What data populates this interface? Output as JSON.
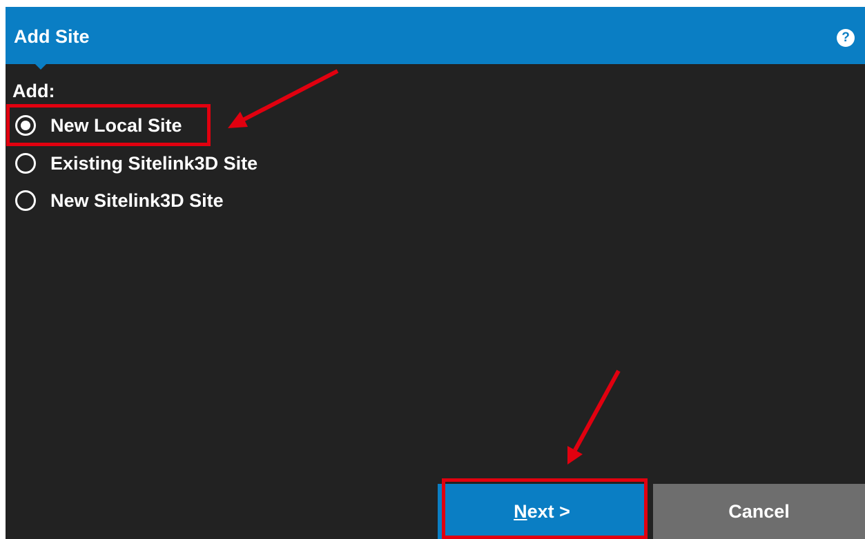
{
  "dialog": {
    "title": "Add Site",
    "help_icon": "help-icon",
    "help_glyph": "?",
    "add_label": "Add:",
    "options": [
      {
        "label": "New Local Site",
        "selected": true
      },
      {
        "label": "Existing Sitelink3D Site",
        "selected": false
      },
      {
        "label": "New Sitelink3D Site",
        "selected": false
      }
    ],
    "buttons": {
      "next_mnemonic": "N",
      "next_rest": "ext >",
      "cancel": "Cancel"
    }
  },
  "colors": {
    "title_bar": "#0a7ec4",
    "background": "#222222",
    "cancel_button": "#6e6e6e",
    "annotation": "#e1000f"
  }
}
